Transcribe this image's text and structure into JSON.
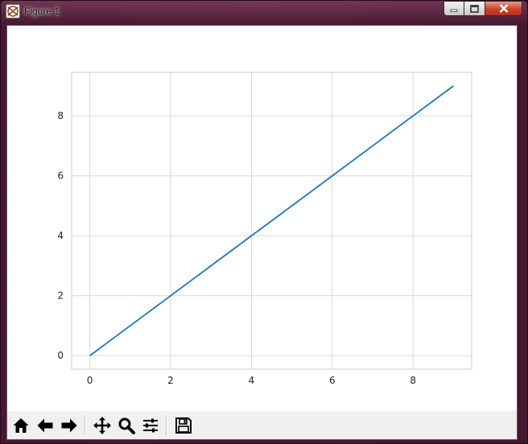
{
  "window": {
    "title": "Figure 1",
    "controls": [
      "minimize-icon",
      "maximize-icon",
      "close-icon"
    ]
  },
  "toolbar": {
    "buttons": [
      {
        "name": "home-button",
        "icon": "home-icon"
      },
      {
        "name": "back-button",
        "icon": "arrow-left-icon"
      },
      {
        "name": "forward-button",
        "icon": "arrow-right-icon"
      },
      {
        "name": "pan-button",
        "icon": "move-icon"
      },
      {
        "name": "zoom-button",
        "icon": "magnifier-icon"
      },
      {
        "name": "subplots-button",
        "icon": "sliders-icon"
      },
      {
        "name": "save-button",
        "icon": "floppy-disk-icon"
      }
    ]
  },
  "chart_data": {
    "type": "line",
    "title": "",
    "xlabel": "",
    "ylabel": "",
    "x": [
      0,
      1,
      2,
      3,
      4,
      5,
      6,
      7,
      8,
      9
    ],
    "series": [
      {
        "values": [
          0,
          1,
          2,
          3,
          4,
          5,
          6,
          7,
          8,
          9
        ],
        "color": "#1f77b4"
      }
    ],
    "xlim": [
      -0.45,
      9.45
    ],
    "ylim": [
      -0.45,
      9.45
    ],
    "xticks": [
      "0",
      "2",
      "4",
      "6",
      "8"
    ],
    "yticks": [
      "0",
      "2",
      "4",
      "6",
      "8"
    ],
    "grid": true,
    "legend": "none"
  }
}
